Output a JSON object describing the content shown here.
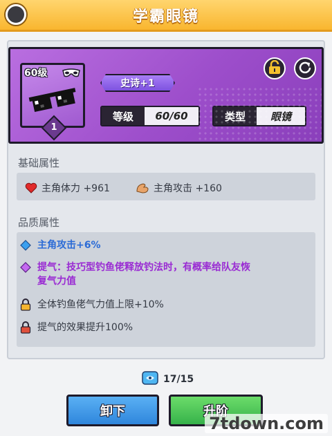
{
  "title": "学霸眼镜",
  "item": {
    "level_tag": "60级",
    "star_count": "1",
    "rarity": "史诗+1",
    "grade_label": "等级",
    "grade_value": "60/60",
    "type_label": "类型",
    "type_value": "眼镜"
  },
  "basic": {
    "title": "基础属性",
    "attrs": [
      {
        "text": "主角体力 +961"
      },
      {
        "text": "主角攻击 +160"
      }
    ]
  },
  "quality": {
    "title": "品质属性",
    "lines": [
      {
        "text": "主角攻击+6%",
        "color": "#2b6bd6"
      },
      {
        "text": "提气：技巧型钓鱼佬释放钓法时，有概率给队友恢复气力值",
        "line1": "提气：技巧型钓鱼佬释放钓法时，有概率给队友恢",
        "line2": "复气力值",
        "color": "#9a2bd3"
      },
      {
        "text": "全体钓鱼佬气力值上限+10%",
        "color": "#353a44"
      },
      {
        "text": "提气的效果提升100%",
        "color": "#353a44"
      }
    ]
  },
  "currency": {
    "value": "17/15"
  },
  "buttons": {
    "unequip": "卸下",
    "upgrade": "升阶"
  },
  "watermark": "7tdown.com",
  "colors": {
    "title_bar": "#f9b62f",
    "card": "#9d4ecb",
    "unequip_btn": "#3b93e6",
    "upgrade_btn": "#46c25a"
  }
}
